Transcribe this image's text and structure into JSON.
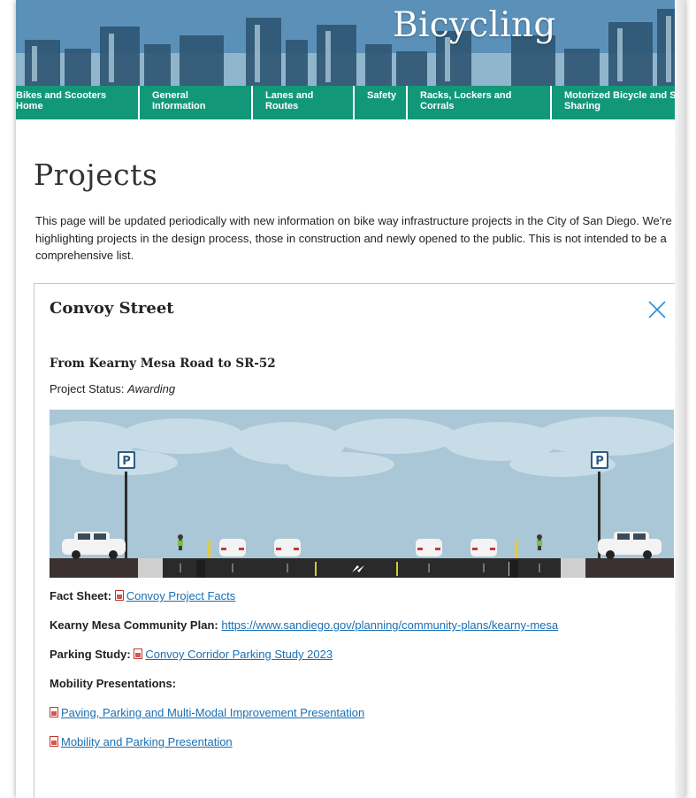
{
  "banner": {
    "title": "Bicycling"
  },
  "nav": {
    "items": [
      {
        "line1": "Bikes and Scooters",
        "line2": "Home"
      },
      {
        "line1": "General",
        "line2": "Information"
      },
      {
        "line1": "Lanes and",
        "line2": "Routes"
      },
      {
        "line1": "Safety",
        "line2": ""
      },
      {
        "line1": "Racks, Lockers and",
        "line2": "Corrals"
      },
      {
        "line1": "Motorized Bicycle and Sc",
        "line2": "Sharing"
      }
    ]
  },
  "main": {
    "title": "Projects",
    "intro": "This page will be updated periodically with new information on bike way infrastructure projects in the City of San Diego. We're highlighting projects in the design process, those in construction and newly opened to the public. This is not intended to be a comprehensive list."
  },
  "project": {
    "name": "Convoy Street",
    "subheading": "From Kearny Mesa Road to SR-52",
    "status_label": "Project Status:",
    "status_value": "Awarding",
    "fact_sheet_label": "Fact Sheet:",
    "fact_sheet_link": "Convoy Project Facts",
    "community_plan_label": "Kearny Mesa Community Plan:",
    "community_plan_link": "https://www.sandiego.gov/planning/community-plans/kearny-mesa",
    "parking_label": "Parking Study:",
    "parking_link": "Convoy Corridor Parking Study 2023",
    "mobility_label": "Mobility Presentations:",
    "presentations": [
      "Paving, Parking and Multi-Modal Improvement Presentation",
      "Mobility and Parking Presentation"
    ],
    "illustration_sign": "P"
  },
  "colors": {
    "nav_bg": "#139779",
    "link": "#1a6fb3",
    "sky": "#a9c7d6"
  },
  "icons": [
    "close-icon",
    "pdf-icon"
  ]
}
